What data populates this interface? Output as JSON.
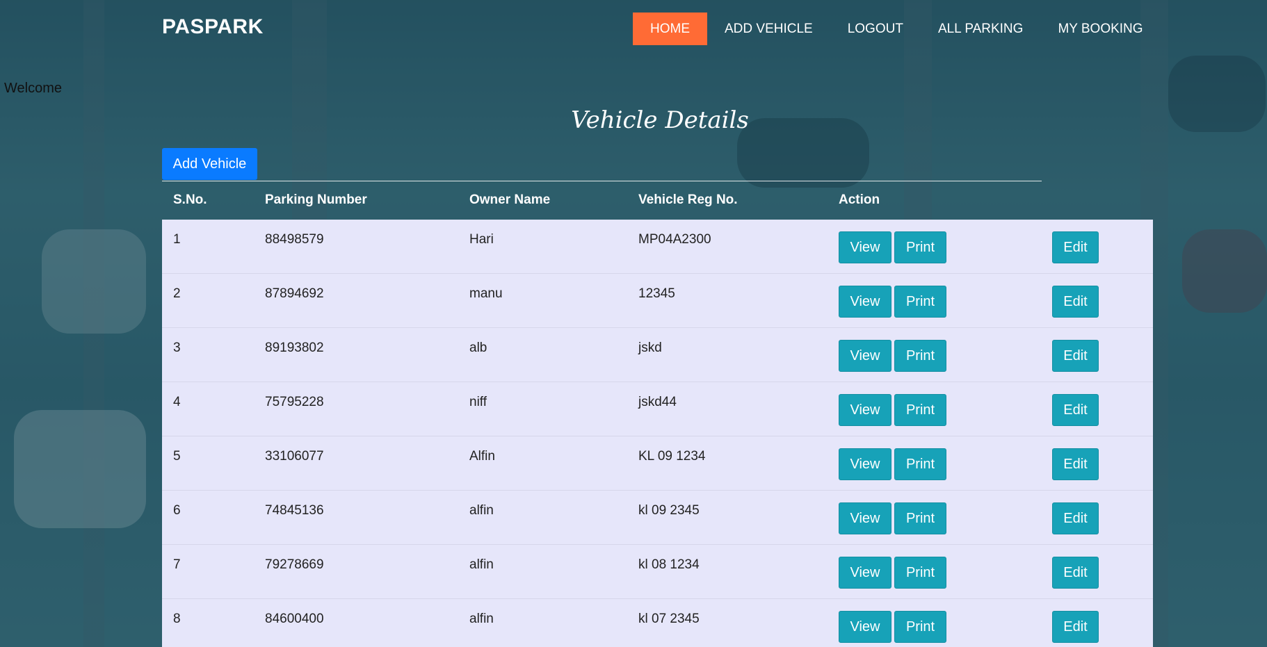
{
  "brand": "PASPARK",
  "nav": [
    {
      "label": "HOME",
      "active": true
    },
    {
      "label": "ADD VEHICLE",
      "active": false
    },
    {
      "label": "LOGOUT",
      "active": false
    },
    {
      "label": "ALL PARKING",
      "active": false
    },
    {
      "label": "MY BOOKING",
      "active": false
    }
  ],
  "welcome": "Welcome",
  "page_title": "Vehicle Details",
  "add_vehicle_label": "Add Vehicle",
  "table": {
    "headers": {
      "sno": "S.No.",
      "parking_number": "Parking Number",
      "owner_name": "Owner Name",
      "vehicle_reg": "Vehicle Reg No.",
      "action": "Action"
    },
    "buttons": {
      "view": "View",
      "print": "Print",
      "edit": "Edit"
    },
    "rows": [
      {
        "sno": "1",
        "parking_number": "88498579",
        "owner_name": "Hari",
        "vehicle_reg": "MP04A2300"
      },
      {
        "sno": "2",
        "parking_number": "87894692",
        "owner_name": "manu",
        "vehicle_reg": "12345"
      },
      {
        "sno": "3",
        "parking_number": "89193802",
        "owner_name": "alb",
        "vehicle_reg": "jskd"
      },
      {
        "sno": "4",
        "parking_number": "75795228",
        "owner_name": "niff",
        "vehicle_reg": "jskd44"
      },
      {
        "sno": "5",
        "parking_number": "33106077",
        "owner_name": "Alfin",
        "vehicle_reg": "KL 09 1234"
      },
      {
        "sno": "6",
        "parking_number": "74845136",
        "owner_name": "alfin",
        "vehicle_reg": "kl 09 2345"
      },
      {
        "sno": "7",
        "parking_number": "79278669",
        "owner_name": "alfin",
        "vehicle_reg": "kl 08 1234"
      },
      {
        "sno": "8",
        "parking_number": "84600400",
        "owner_name": "alfin",
        "vehicle_reg": "kl 07 2345"
      }
    ]
  },
  "colors": {
    "nav_active": "#ff6b35",
    "add_button": "#0a7bff",
    "action_button": "#17a2b8",
    "table_body": "#e6e6fa"
  }
}
